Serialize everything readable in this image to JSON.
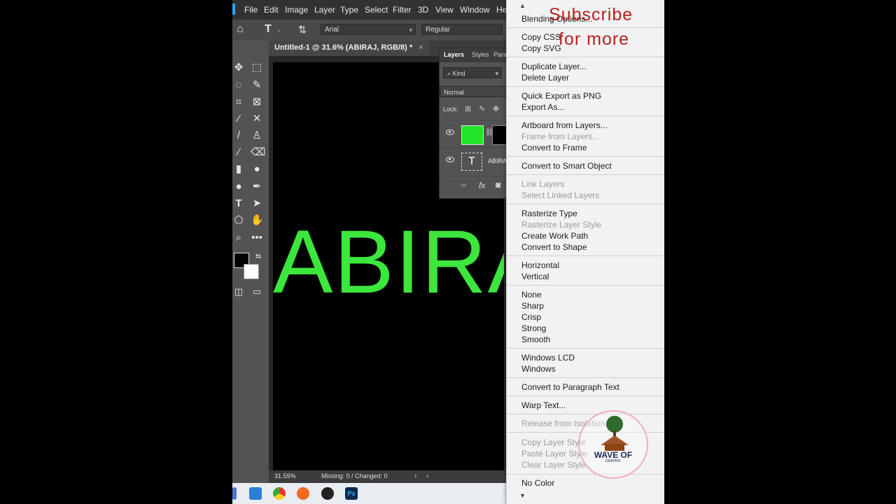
{
  "menubar": {
    "items": [
      "File",
      "Edit",
      "Image",
      "Layer",
      "Type",
      "Select",
      "Filter",
      "3D",
      "View",
      "Window",
      "He"
    ]
  },
  "options": {
    "font_family": "Arial",
    "font_style": "Regular"
  },
  "document": {
    "tab_title": "Untitled-1 @ 31.6% (ABIRAJ, RGB/8) *",
    "canvas_text": "ABIRA",
    "canvas_text_color": "#3ce63c"
  },
  "status": {
    "zoom": "31.59%",
    "info": "Missing: 0 / Changed: 0"
  },
  "layers_panel": {
    "tabs": [
      "Layers",
      "Styles",
      "Para"
    ],
    "filter": "Kind",
    "blend_mode": "Normal",
    "lock_label": "Lock:",
    "layers": [
      {
        "name": "",
        "thumb_color": "#22e52a"
      },
      {
        "name": "ABIRA",
        "type_icon": "T"
      }
    ],
    "footer_fx": "fx"
  },
  "context_menu": {
    "items": [
      {
        "label": "Blending Options...",
        "enabled": true
      },
      {
        "label": "Copy CSS",
        "enabled": true
      },
      {
        "label": "Copy SVG",
        "enabled": true
      },
      {
        "label": "Duplicate Layer...",
        "enabled": true
      },
      {
        "label": "Delete Layer",
        "enabled": true
      },
      {
        "label": "Quick Export as PNG",
        "enabled": true
      },
      {
        "label": "Export As...",
        "enabled": true
      },
      {
        "label": "Artboard from Layers...",
        "enabled": true
      },
      {
        "label": "Frame from Layers...",
        "enabled": false
      },
      {
        "label": "Convert to Frame",
        "enabled": true
      },
      {
        "label": "Convert to Smart Object",
        "enabled": true
      },
      {
        "label": "Link Layers",
        "enabled": false
      },
      {
        "label": "Select Linked Layers",
        "enabled": false
      },
      {
        "label": "Rasterize Type",
        "enabled": true
      },
      {
        "label": "Rasterize Layer Style",
        "enabled": false
      },
      {
        "label": "Create Work Path",
        "enabled": true
      },
      {
        "label": "Convert to Shape",
        "enabled": true
      },
      {
        "label": "Horizontal",
        "enabled": true
      },
      {
        "label": "Vertical",
        "enabled": true
      },
      {
        "label": "None",
        "enabled": true
      },
      {
        "label": "Sharp",
        "enabled": true
      },
      {
        "label": "Crisp",
        "enabled": true
      },
      {
        "label": "Strong",
        "enabled": true
      },
      {
        "label": "Smooth",
        "enabled": true
      },
      {
        "label": "Windows LCD",
        "enabled": true
      },
      {
        "label": "Windows",
        "enabled": true
      },
      {
        "label": "Convert to Paragraph Text",
        "enabled": true
      },
      {
        "label": "Warp Text...",
        "enabled": true
      },
      {
        "label": "Release from Isolation",
        "enabled": false
      },
      {
        "label": "Copy Layer Style",
        "enabled": false
      },
      {
        "label": "Paste Layer Style",
        "enabled": false
      },
      {
        "label": "Clear Layer Style",
        "enabled": false
      },
      {
        "label": "No Color",
        "enabled": true
      }
    ],
    "scroll_up": "▲",
    "scroll_down": "▼"
  },
  "overlay": {
    "subscribe_line1": "Subscribe",
    "subscribe_line2": "for more",
    "logo_text": "WAVE OF",
    "logo_subtext": "GRAPHIC"
  }
}
